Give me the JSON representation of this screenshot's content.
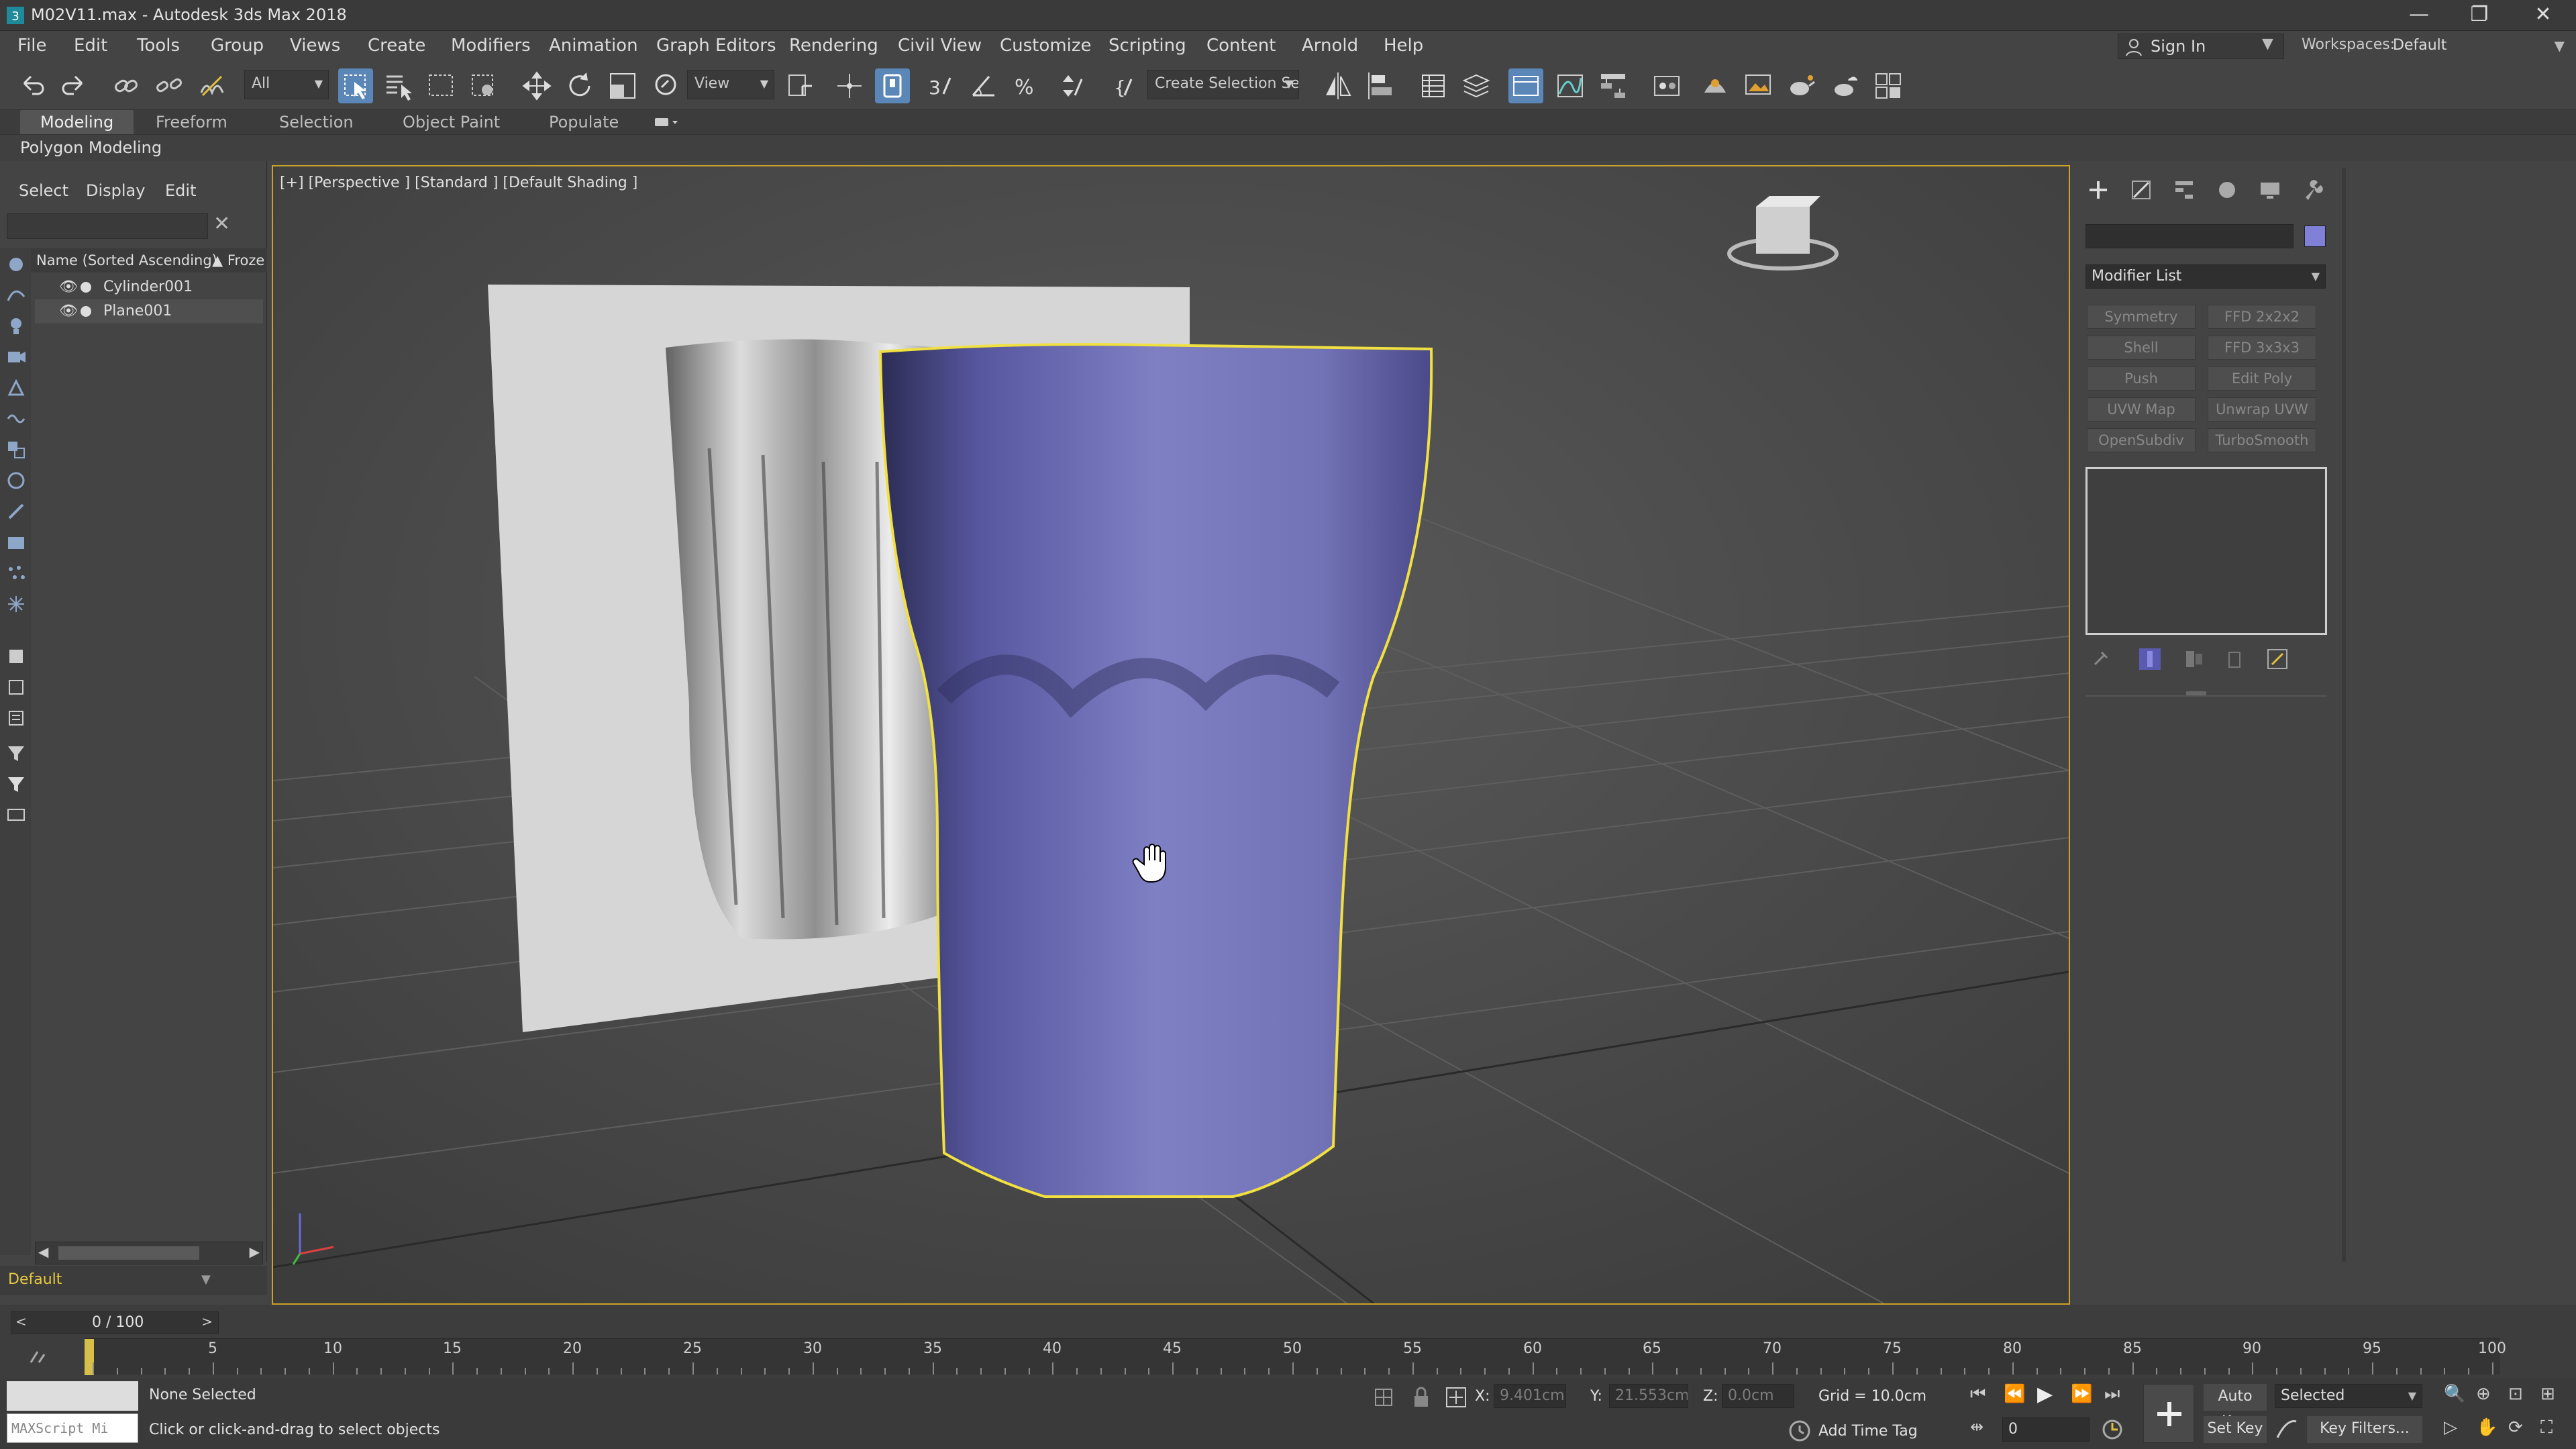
{
  "window": {
    "title": "M02V11.max - Autodesk 3ds Max 2018",
    "minimize": "—",
    "restore": "❐",
    "close": "✕"
  },
  "menu": [
    "File",
    "Edit",
    "Tools",
    "Group",
    "Views",
    "Create",
    "Modifiers",
    "Animation",
    "Graph Editors",
    "Rendering",
    "Civil View",
    "Customize",
    "Scripting",
    "Content",
    "Arnold",
    "Help"
  ],
  "account": {
    "sign_in": "Sign In",
    "workspaces_label": "Workspaces:",
    "workspace_value": "Default"
  },
  "toolbar": {
    "filter_value": "All",
    "ref_coord_value": "View",
    "selection_set_value": "Create Selection Se"
  },
  "ribbon": {
    "tabs": [
      "Modeling",
      "Freeform",
      "Selection",
      "Object Paint",
      "Populate"
    ],
    "active_tab": "Modeling",
    "panel_label": "Polygon Modeling"
  },
  "explorer": {
    "tabs": [
      "Select",
      "Display",
      "Edit"
    ],
    "column_name": "Name (Sorted Ascending)",
    "column_frozen": "▲ Froze",
    "items": [
      "Cylinder001",
      "Plane001"
    ],
    "layer": "Default"
  },
  "viewport": {
    "label": "[+] [Perspective ] [Standard ] [Default Shading ]"
  },
  "command_panel": {
    "modifier_list": "Modifier List",
    "object_color": "#8080d8",
    "modifier_buttons": [
      "Symmetry",
      "FFD 2x2x2",
      "Shell",
      "FFD 3x3x3",
      "Push",
      "Edit Poly",
      "UVW Map",
      "Unwrap UVW",
      "OpenSubdiv",
      "TurboSmooth"
    ]
  },
  "timeline": {
    "frame_indicator": "0 / 100",
    "ticks": [
      "5",
      "10",
      "15",
      "20",
      "25",
      "30",
      "35",
      "40",
      "45",
      "50",
      "55",
      "60",
      "65",
      "70",
      "75",
      "80",
      "85",
      "90",
      "95",
      "100"
    ]
  },
  "status": {
    "maxscript": "MAXScript Mi",
    "selection": "None Selected",
    "prompt": "Click or click-and-drag to select objects",
    "x_label": "X:",
    "x_value": "9.401cm",
    "y_label": "Y:",
    "y_value": "21.553cm",
    "z_label": "Z:",
    "z_value": "0.0cm",
    "grid": "Grid = 10.0cm",
    "add_time_tag": "Add Time Tag",
    "auto_key": "Auto Key",
    "set_key": "Set Key",
    "selected_value": "Selected",
    "key_filters": "Key Filters...",
    "frame_value": "0"
  },
  "colors": {
    "accent": "#c9a227",
    "selection_outline": "#f0e040",
    "cylinder": "#7c7cc2"
  }
}
